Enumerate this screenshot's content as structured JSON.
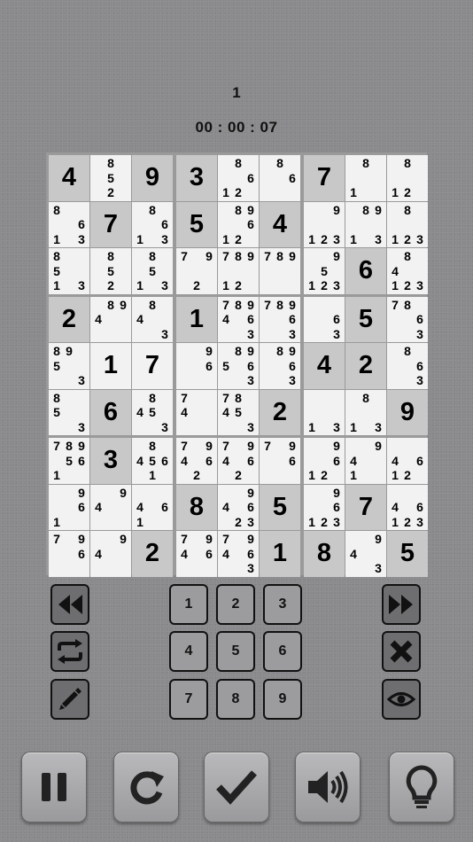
{
  "header": {
    "level": "1",
    "timer": "00 : 00 : 07"
  },
  "board": {
    "cells": [
      [
        {
          "v": "4",
          "given": true
        },
        {
          "n": [
            0,
            8,
            0,
            0,
            5,
            0,
            0,
            2,
            0
          ]
        },
        {
          "v": "9",
          "given": true
        },
        {
          "v": "3",
          "given": true
        },
        {
          "n": [
            0,
            8,
            0,
            0,
            0,
            6,
            1,
            2,
            0
          ]
        },
        {
          "n": [
            0,
            8,
            0,
            0,
            0,
            6,
            0,
            0,
            0
          ]
        },
        {
          "v": "7",
          "given": true
        },
        {
          "n": [
            0,
            8,
            0,
            0,
            0,
            0,
            1,
            0,
            0
          ]
        },
        {
          "n": [
            0,
            8,
            0,
            0,
            0,
            0,
            1,
            2,
            0
          ]
        }
      ],
      [
        {
          "n": [
            8,
            0,
            0,
            0,
            0,
            6,
            1,
            0,
            3
          ]
        },
        {
          "v": "7",
          "given": true
        },
        {
          "n": [
            0,
            8,
            0,
            0,
            0,
            6,
            1,
            0,
            3
          ]
        },
        {
          "v": "5",
          "given": true
        },
        {
          "n": [
            0,
            8,
            9,
            0,
            0,
            6,
            1,
            2,
            0
          ]
        },
        {
          "v": "4",
          "given": true
        },
        {
          "n": [
            0,
            0,
            9,
            0,
            0,
            0,
            1,
            2,
            3
          ]
        },
        {
          "n": [
            0,
            8,
            9,
            0,
            0,
            0,
            1,
            0,
            3
          ]
        },
        {
          "n": [
            0,
            8,
            0,
            0,
            0,
            0,
            1,
            2,
            3
          ]
        }
      ],
      [
        {
          "n": [
            8,
            0,
            0,
            5,
            0,
            0,
            1,
            0,
            3
          ]
        },
        {
          "n": [
            0,
            8,
            0,
            0,
            5,
            0,
            0,
            2,
            0
          ]
        },
        {
          "n": [
            0,
            8,
            0,
            0,
            5,
            0,
            1,
            0,
            3
          ]
        },
        {
          "n": [
            7,
            0,
            9,
            0,
            0,
            0,
            0,
            2,
            0
          ]
        },
        {
          "n": [
            7,
            8,
            9,
            0,
            0,
            0,
            1,
            2,
            0
          ]
        },
        {
          "n": [
            7,
            8,
            9,
            0,
            0,
            0,
            0,
            0,
            0
          ]
        },
        {
          "n": [
            0,
            0,
            9,
            0,
            5,
            0,
            1,
            2,
            3
          ]
        },
        {
          "v": "6",
          "given": true
        },
        {
          "n": [
            0,
            8,
            0,
            4,
            0,
            0,
            1,
            2,
            3
          ]
        }
      ],
      [
        {
          "v": "2",
          "given": true
        },
        {
          "n": [
            0,
            8,
            9,
            4,
            0,
            0,
            0,
            0,
            0
          ]
        },
        {
          "n": [
            0,
            8,
            0,
            4,
            0,
            0,
            0,
            0,
            3
          ]
        },
        {
          "v": "1",
          "given": true
        },
        {
          "n": [
            7,
            8,
            9,
            4,
            0,
            6,
            0,
            0,
            3
          ]
        },
        {
          "n": [
            7,
            8,
            9,
            0,
            0,
            6,
            0,
            0,
            3
          ]
        },
        {
          "n": [
            0,
            0,
            0,
            0,
            0,
            6,
            0,
            0,
            3
          ]
        },
        {
          "v": "5",
          "given": true
        },
        {
          "n": [
            7,
            8,
            0,
            0,
            0,
            6,
            0,
            0,
            3
          ]
        }
      ],
      [
        {
          "n": [
            8,
            9,
            0,
            5,
            0,
            0,
            0,
            0,
            3
          ]
        },
        {
          "v": "1"
        },
        {
          "v": "7"
        },
        {
          "n": [
            0,
            0,
            9,
            0,
            0,
            6,
            0,
            0,
            0
          ]
        },
        {
          "n": [
            0,
            8,
            9,
            5,
            0,
            6,
            0,
            0,
            3
          ]
        },
        {
          "n": [
            0,
            8,
            9,
            0,
            0,
            6,
            0,
            0,
            3
          ]
        },
        {
          "v": "4",
          "given": true
        },
        {
          "v": "2",
          "given": true
        },
        {
          "n": [
            0,
            8,
            0,
            0,
            0,
            6,
            0,
            0,
            3
          ]
        }
      ],
      [
        {
          "n": [
            8,
            0,
            0,
            5,
            0,
            0,
            0,
            0,
            3
          ]
        },
        {
          "v": "6",
          "given": true
        },
        {
          "n": [
            0,
            8,
            0,
            4,
            5,
            0,
            0,
            0,
            3
          ]
        },
        {
          "n": [
            7,
            0,
            0,
            4,
            0,
            0,
            0,
            0,
            0
          ]
        },
        {
          "n": [
            7,
            8,
            0,
            4,
            5,
            0,
            0,
            0,
            3
          ]
        },
        {
          "v": "2",
          "given": true
        },
        {
          "n": [
            0,
            0,
            0,
            0,
            0,
            0,
            1,
            0,
            3
          ]
        },
        {
          "n": [
            0,
            8,
            0,
            0,
            0,
            0,
            1,
            0,
            3
          ]
        },
        {
          "v": "9",
          "given": true
        }
      ],
      [
        {
          "n": [
            7,
            8,
            9,
            0,
            5,
            6,
            1,
            0,
            0
          ]
        },
        {
          "v": "3",
          "given": true
        },
        {
          "n": [
            0,
            8,
            0,
            4,
            5,
            6,
            0,
            1,
            0
          ]
        },
        {
          "n": [
            7,
            0,
            9,
            4,
            0,
            6,
            0,
            2,
            0
          ]
        },
        {
          "n": [
            7,
            0,
            9,
            4,
            0,
            6,
            0,
            2,
            0
          ]
        },
        {
          "n": [
            7,
            0,
            9,
            0,
            0,
            6,
            0,
            0,
            0
          ]
        },
        {
          "n": [
            0,
            0,
            9,
            0,
            0,
            6,
            1,
            2,
            0
          ]
        },
        {
          "n": [
            0,
            0,
            9,
            4,
            0,
            0,
            1,
            0,
            0
          ]
        },
        {
          "n": [
            0,
            0,
            0,
            4,
            0,
            6,
            1,
            2,
            0
          ]
        }
      ],
      [
        {
          "n": [
            0,
            0,
            9,
            0,
            0,
            6,
            1,
            0,
            0
          ]
        },
        {
          "n": [
            0,
            0,
            9,
            4,
            0,
            0,
            0,
            0,
            0
          ]
        },
        {
          "n": [
            0,
            0,
            0,
            4,
            0,
            6,
            1,
            0,
            0
          ]
        },
        {
          "v": "8",
          "given": true
        },
        {
          "n": [
            0,
            0,
            9,
            4,
            0,
            6,
            0,
            2,
            3
          ]
        },
        {
          "v": "5",
          "given": true
        },
        {
          "n": [
            0,
            0,
            9,
            0,
            0,
            6,
            1,
            2,
            3
          ]
        },
        {
          "v": "7",
          "given": true
        },
        {
          "n": [
            0,
            0,
            0,
            4,
            0,
            6,
            1,
            2,
            3
          ]
        }
      ],
      [
        {
          "n": [
            7,
            0,
            9,
            0,
            0,
            6,
            0,
            0,
            0
          ]
        },
        {
          "n": [
            0,
            0,
            9,
            4,
            0,
            0,
            0,
            0,
            0
          ]
        },
        {
          "v": "2",
          "given": true
        },
        {
          "n": [
            7,
            0,
            9,
            4,
            0,
            6,
            0,
            0,
            0
          ]
        },
        {
          "n": [
            7,
            0,
            9,
            4,
            0,
            6,
            0,
            0,
            3
          ]
        },
        {
          "v": "1",
          "given": true
        },
        {
          "v": "8",
          "given": true
        },
        {
          "n": [
            0,
            0,
            9,
            4,
            0,
            0,
            0,
            0,
            3
          ]
        },
        {
          "v": "5",
          "given": true
        }
      ]
    ]
  },
  "controls": {
    "left": [
      {
        "name": "rewind-button",
        "icon": "rewind-icon"
      },
      {
        "name": "repeat-button",
        "icon": "repeat-icon"
      },
      {
        "name": "pencil-button",
        "icon": "pencil-icon"
      }
    ],
    "right": [
      {
        "name": "fast-forward-button",
        "icon": "fast-forward-icon"
      },
      {
        "name": "erase-button",
        "icon": "close-icon"
      },
      {
        "name": "reveal-button",
        "icon": "eye-icon"
      }
    ],
    "numbers": [
      "1",
      "2",
      "3",
      "4",
      "5",
      "6",
      "7",
      "8",
      "9"
    ]
  },
  "bottom_bar": [
    {
      "name": "pause-button",
      "icon": "pause-icon"
    },
    {
      "name": "restart-button",
      "icon": "refresh-icon"
    },
    {
      "name": "check-button",
      "icon": "check-icon"
    },
    {
      "name": "sound-button",
      "icon": "speaker-icon"
    },
    {
      "name": "hint-button",
      "icon": "lightbulb-icon"
    }
  ]
}
